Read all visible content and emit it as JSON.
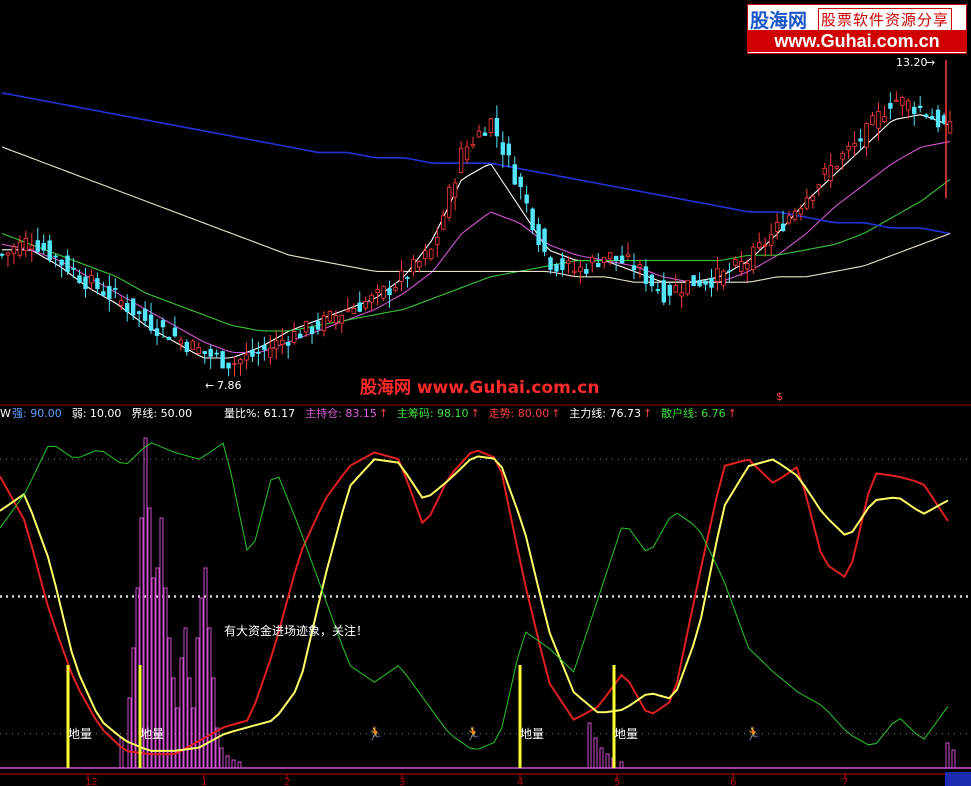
{
  "watermark": {
    "site": "股海网",
    "tagline": "股票软件资源分享",
    "url": "www.Guhai.com.cn",
    "center_text": "股海网 www.Guhai.com.cn"
  },
  "colors": {
    "background": "#000000",
    "up_candle": "#ff3b3b",
    "down_candle": "#54e6ff",
    "ma_white": "#ffffff",
    "ma_magenta": "#d256d2",
    "ma_green": "#39c639",
    "ma_blue": "#2233d8",
    "ma_cream": "#e8e3c8",
    "main_holding_line": "#e02020",
    "trend_line": "#ffff66",
    "retail_line": "#28c828",
    "volume_bar": "#d050d0",
    "signal_bar": "#ffff33",
    "separator": "#c00000"
  },
  "price_panel": {
    "high_label": "13.20",
    "low_label": "7.86",
    "marker": "$"
  },
  "indicator_header": {
    "prefix": "W",
    "items": [
      {
        "label": "强: ",
        "value": "90.00",
        "color": "#5ea0ff"
      },
      {
        "label": "弱: ",
        "value": "10.00",
        "color": "#ffffff"
      },
      {
        "label": "界线: ",
        "value": "50.00",
        "color": "#ffffff"
      },
      {
        "label": "量比%: ",
        "value": "61.17",
        "color": "#ffffff"
      },
      {
        "label": "主持仓: ",
        "value": "83.15",
        "color": "#e060e0",
        "arrow": "↑",
        "arrow_color": "#ff4040"
      },
      {
        "label": "主筹码: ",
        "value": "98.10",
        "color": "#40e040",
        "arrow": "↑",
        "arrow_color": "#ff4040"
      },
      {
        "label": "走势: ",
        "value": "80.00",
        "color": "#ff4040",
        "arrow": "↑",
        "arrow_color": "#ff4040"
      },
      {
        "label": "主力线: ",
        "value": "76.73",
        "color": "#ffffff",
        "arrow": "↑",
        "arrow_color": "#ff4040"
      },
      {
        "label": "散户线: ",
        "value": "6.76",
        "color": "#40e040",
        "arrow": "↑",
        "arrow_color": "#ff4040"
      }
    ]
  },
  "annotations": {
    "capital_entry": "有大资金进场迹象，关注！",
    "signal_label": "地量",
    "runner_icon": "runner-icon"
  },
  "x_axis_ticks": [
    "12",
    "1",
    "2",
    "3",
    "4",
    "5",
    "6",
    "7"
  ],
  "chart_data": [
    {
      "type": "candlestick",
      "title": "",
      "high_label": "13.20",
      "low_label": "7.86",
      "close_path": [
        9.9,
        10.2,
        9.8,
        9.4,
        9.1,
        8.7,
        8.4,
        8.1,
        7.9,
        8.1,
        8.4,
        8.6,
        8.9,
        9.1,
        9.5,
        10.0,
        11.8,
        12.4,
        11.2,
        9.8,
        9.6,
        9.9,
        9.7,
        9.2,
        9.4,
        9.5,
        9.8,
        10.4,
        11.0,
        11.6,
        12.1,
        12.8,
        12.6,
        12.2
      ],
      "moving_averages": [
        {
          "color": "white",
          "values": [
            10.0,
            10.0,
            9.7,
            9.3,
            9.0,
            8.6,
            8.3,
            8.0,
            8.0,
            8.2,
            8.5,
            8.7,
            8.9,
            9.1,
            9.5,
            10.2,
            11.3,
            11.6,
            10.8,
            10.0,
            9.8,
            9.8,
            9.6,
            9.4,
            9.4,
            9.5,
            9.8,
            10.3,
            10.9,
            11.4,
            11.9,
            12.4,
            12.5,
            12.3
          ]
        },
        {
          "color": "magenta",
          "values": [
            10.1,
            10.0,
            9.8,
            9.5,
            9.2,
            8.9,
            8.6,
            8.3,
            8.1,
            8.1,
            8.3,
            8.5,
            8.7,
            8.9,
            9.2,
            9.6,
            10.3,
            10.7,
            10.5,
            10.1,
            9.9,
            9.8,
            9.7,
            9.5,
            9.4,
            9.4,
            9.6,
            9.9,
            10.3,
            10.8,
            11.2,
            11.6,
            11.9,
            12.0
          ]
        },
        {
          "color": "green",
          "values": [
            10.3,
            10.1,
            9.9,
            9.7,
            9.5,
            9.2,
            9.0,
            8.8,
            8.6,
            8.5,
            8.5,
            8.6,
            8.7,
            8.8,
            8.9,
            9.1,
            9.3,
            9.5,
            9.6,
            9.7,
            9.8,
            9.8,
            9.8,
            9.8,
            9.8,
            9.8,
            9.9,
            9.9,
            10.0,
            10.1,
            10.3,
            10.6,
            10.9,
            11.3
          ]
        },
        {
          "color": "blue",
          "values": [
            12.9,
            12.8,
            12.7,
            12.6,
            12.5,
            12.4,
            12.3,
            12.2,
            12.1,
            12.0,
            11.9,
            11.8,
            11.8,
            11.7,
            11.7,
            11.6,
            11.6,
            11.6,
            11.5,
            11.4,
            11.3,
            11.2,
            11.1,
            11.0,
            10.9,
            10.8,
            10.7,
            10.7,
            10.6,
            10.5,
            10.5,
            10.4,
            10.4,
            10.3
          ]
        },
        {
          "color": "cream",
          "values": [
            11.9,
            11.7,
            11.5,
            11.3,
            11.1,
            10.9,
            10.7,
            10.5,
            10.3,
            10.1,
            9.9,
            9.8,
            9.7,
            9.6,
            9.6,
            9.6,
            9.6,
            9.6,
            9.6,
            9.6,
            9.5,
            9.5,
            9.4,
            9.4,
            9.4,
            9.4,
            9.4,
            9.5,
            9.5,
            9.6,
            9.7,
            9.9,
            10.1,
            10.3
          ]
        }
      ]
    },
    {
      "type": "line",
      "title": "",
      "ylim": [
        0,
        100
      ],
      "reference_lines": [
        {
          "name": "强",
          "value": 90
        },
        {
          "name": "界线",
          "value": 50
        },
        {
          "name": "弱",
          "value": 10
        }
      ],
      "series": [
        {
          "name": "主持仓",
          "color": "red",
          "values": [
            85,
            72,
            45,
            25,
            12,
            5,
            4,
            4,
            8,
            12,
            14,
            35,
            62,
            78,
            88,
            92,
            90,
            70,
            85,
            93,
            90,
            55,
            25,
            14,
            18,
            28,
            15,
            20,
            55,
            88,
            90,
            83,
            88,
            60,
            55,
            86,
            85,
            83,
            72
          ]
        },
        {
          "name": "走势",
          "color": "yellow",
          "values": [
            75,
            80,
            60,
            30,
            14,
            8,
            5,
            5,
            6,
            10,
            12,
            14,
            24,
            55,
            82,
            90,
            89,
            78,
            84,
            91,
            90,
            70,
            40,
            22,
            16,
            17,
            22,
            20,
            40,
            76,
            88,
            90,
            85,
            74,
            67,
            78,
            79,
            74,
            78
          ]
        },
        {
          "name": "散户线",
          "color": "green",
          "values": [
            70,
            80,
            95,
            90,
            93,
            88,
            95,
            92,
            90,
            95,
            60,
            88,
            70,
            50,
            30,
            25,
            30,
            20,
            10,
            5,
            8,
            40,
            35,
            28,
            50,
            72,
            62,
            75,
            70,
            55,
            35,
            28,
            22,
            18,
            10,
            6,
            15,
            8,
            18
          ]
        }
      ]
    }
  ]
}
